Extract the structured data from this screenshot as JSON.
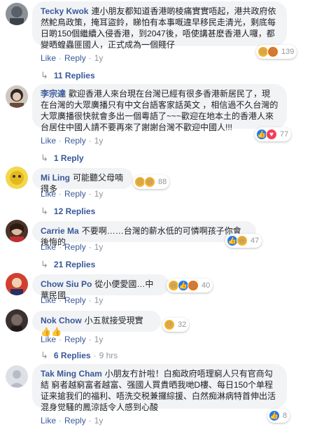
{
  "comments": [
    {
      "author": "Tecky Kwok",
      "text": "連小朋友都知道香港啲棱痛實實唔起，港共政府依然鮀鳥政策，掩耳盜鈴，睇怕有本事嘅違早移民走清光，剩底每日啲150個繼續入侵香港，到2047後，唔使講甚麽香港人囉，都變晒蝗蟲匪國人，正式成為一個賤仔",
      "reaction_count": "139",
      "reactions": [
        "sad-icon",
        "angry-icon"
      ],
      "actions": {
        "like": "Like",
        "reply": "Reply",
        "time": "1y"
      },
      "replies": "11 Replies"
    },
    {
      "author": "李宗達",
      "text": "歡迎香港人來台現在台灣已經有很多香港新居民了，現在台灣的大眾廣播只有中文台語客家話英文 ，相信過不久台灣的大眾廣播很快就會多出一個粵語了~~~歡迎在地本土的香港人來台居住中國人請不要再來了謝謝台灣不歡迎中國人!!!",
      "reaction_count": "77",
      "reactions": [
        "like-icon",
        "love-icon"
      ],
      "actions": {
        "like": "Like",
        "reply": "Reply",
        "time": "1y"
      },
      "replies": "1 Reply"
    },
    {
      "author": "Mi Ling",
      "text": "可能聽父母喃得多",
      "reaction_count": "88",
      "reactions": [
        "sad-icon",
        "haha-icon"
      ],
      "actions": {
        "like": "Like",
        "reply": "Reply",
        "time": "1y"
      },
      "replies": "12 Replies"
    },
    {
      "author": "Carrie Ma",
      "text": "不要啊……台灣的薪水低的可憐啊孩子你會後悔的",
      "reaction_count": "47",
      "reactions": [
        "like-icon",
        "haha-icon"
      ],
      "actions": {
        "like": "Like",
        "reply": "Reply",
        "time": "1y"
      },
      "replies": "21 Replies"
    },
    {
      "author": "Chow Siu Po",
      "text": "從小便愛國…中華民國",
      "reaction_count": "40",
      "reactions": [
        "haha-icon",
        "like-icon",
        "angry-icon"
      ],
      "actions": {
        "like": "Like",
        "reply": "Reply",
        "time": "1y"
      },
      "replies": ""
    },
    {
      "author": "Nok Chow",
      "text": "小五就接受現實👍👍",
      "reaction_count": "32",
      "reactions": [
        "sad-icon"
      ],
      "actions": {
        "like": "Like",
        "reply": "Reply",
        "time": "1y"
      },
      "replies": "6 Replies",
      "replies_time": "9 hrs"
    },
    {
      "author": "Tak Ming Cham",
      "text": "小朋友冇計啦！白痴政府唔理窮人只有官商勾結 窮者越窮富者越富、强國人買貴晒我哋D樓、每日150个单程证来搶我们的福利、唔洗交税兼攞綜援、白然痴淋病特首伸出活混身觉騷的鳳涼話令人感到心酸",
      "reaction_count": "8",
      "reactions": [
        "like-icon"
      ],
      "actions": {
        "like": "Like",
        "reply": "Reply",
        "time": "1y"
      },
      "replies": ""
    }
  ],
  "colors": {
    "link": "#385898",
    "bubble": "#f2f3f5",
    "meta": "#90949c",
    "like": "#2078f4",
    "love": "#f33e58",
    "yellow": "#f7b125"
  }
}
